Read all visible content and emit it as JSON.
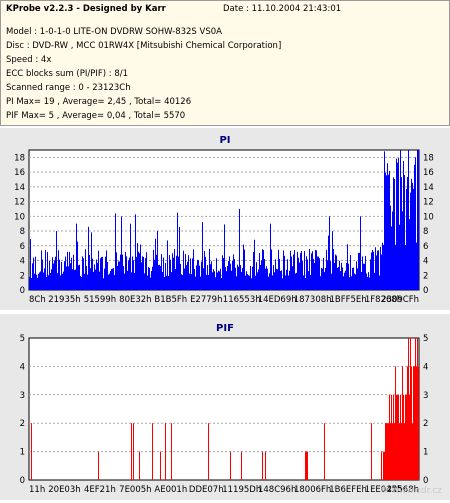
{
  "info": {
    "app_title": "KProbe v2.2.3 - Designed by Karr",
    "date": "Date : 11.10.2004 21:43:01",
    "lines": [
      "Model : 1-0-1-0 LITE-ON DVDRW SOHW-832S  VS0A",
      "Disc : DVD-RW , MCC 01RW4X  [Mitsubishi Chemical Corporation]",
      "Speed : 4x",
      "ECC blocks sum (PI/PIF) : 8/1",
      "Scanned range : 0 - 23123Ch",
      "PI Max= 19 , Average= 2,45 , Total= 40126",
      "PIF Max= 5 , Average= 0,04 , Total= 5570"
    ]
  },
  "watermark": "© www.cdr.cz",
  "chart_data": [
    {
      "type": "bar",
      "title": "PI",
      "color": "#0000ff",
      "ylim": [
        0,
        19
      ],
      "yticks": [
        0,
        2,
        4,
        6,
        8,
        10,
        12,
        14,
        16,
        18
      ],
      "xtick_labels": [
        "8Ch",
        "21935h",
        "51599h",
        "80E32h",
        "B1B5Fh",
        "E2779h",
        "116553h",
        "14ED69h",
        "187308h",
        "1BFF5Eh",
        "1F8268h",
        "2309CFh"
      ],
      "grid": true,
      "summary": {
        "max": 19,
        "average": 2.45,
        "total": 40126
      },
      "profile_x": [
        0,
        0.03,
        0.3,
        0.55,
        0.85,
        0.905,
        0.91,
        0.94,
        0.97,
        1.0
      ],
      "profile_y": [
        4,
        4.5,
        4.5,
        4.5,
        4.5,
        5,
        14,
        16,
        17,
        18
      ],
      "spikes": [
        [
          0.54,
          11
        ],
        [
          0.85,
          10
        ],
        [
          0.77,
          10
        ],
        [
          0.62,
          9
        ],
        [
          0.26,
          9
        ],
        [
          0.12,
          9
        ]
      ]
    },
    {
      "type": "bar",
      "title": "PIF",
      "color": "#ff0000",
      "ylim": [
        0,
        5
      ],
      "yticks": [
        0,
        1,
        2,
        3,
        4,
        5
      ],
      "xtick_labels": [
        "11h",
        "20E03h",
        "4EF21h",
        "7E005h",
        "AE001h",
        "DDE07h",
        "11195Dh",
        "148C96h",
        "18006Fh",
        "1B6EFEh",
        "1EE045h",
        "22568h"
      ],
      "grid": true,
      "summary": {
        "max": 5,
        "average": 0.04,
        "total": 5570
      },
      "profile_x": [
        0,
        0.9,
        0.92,
        0.95,
        1.0
      ],
      "profile_y": [
        0,
        0,
        3,
        4,
        5
      ]
    }
  ]
}
